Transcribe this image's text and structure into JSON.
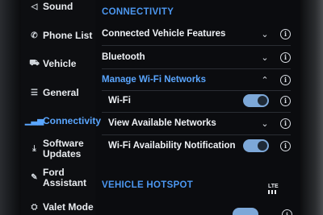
{
  "sidebar": {
    "items": [
      {
        "label": "Sound",
        "icon": "speaker-icon"
      },
      {
        "label": "Phone List",
        "icon": "phone-icon"
      },
      {
        "label": "Vehicle",
        "icon": "car-icon"
      },
      {
        "label": "General",
        "icon": "sliders-icon"
      },
      {
        "label": "Connectivity",
        "icon": "signal-bars-icon",
        "active": true
      },
      {
        "label": "Software Updates",
        "line1": "Software",
        "line2": "Updates",
        "icon": "download-icon"
      },
      {
        "label": "Ford Assistant",
        "line1": "Ford",
        "line2": "Assistant",
        "icon": "assistant-icon"
      },
      {
        "label": "Valet Mode",
        "icon": "valet-icon"
      }
    ]
  },
  "connectivity": {
    "title": "CONNECTIVITY",
    "rows": [
      {
        "label": "Connected Vehicle Features",
        "control": "chevron-down"
      },
      {
        "label": "Bluetooth",
        "control": "chevron-down"
      },
      {
        "label": "Manage Wi-Fi Networks",
        "control": "chevron-up"
      },
      {
        "label": "Wi-Fi",
        "control": "toggle",
        "on": true
      },
      {
        "label": "View Available Networks",
        "control": "chevron-down"
      },
      {
        "label": "Wi-Fi Availability Notification",
        "control": "toggle",
        "on": true
      }
    ]
  },
  "hotspot": {
    "title": "VEHICLE HOTSPOT",
    "badge": "LTE"
  },
  "colors": {
    "accent": "#4c97f0",
    "toggle_on": "#7da8d8",
    "background": "#0b0c0f"
  }
}
